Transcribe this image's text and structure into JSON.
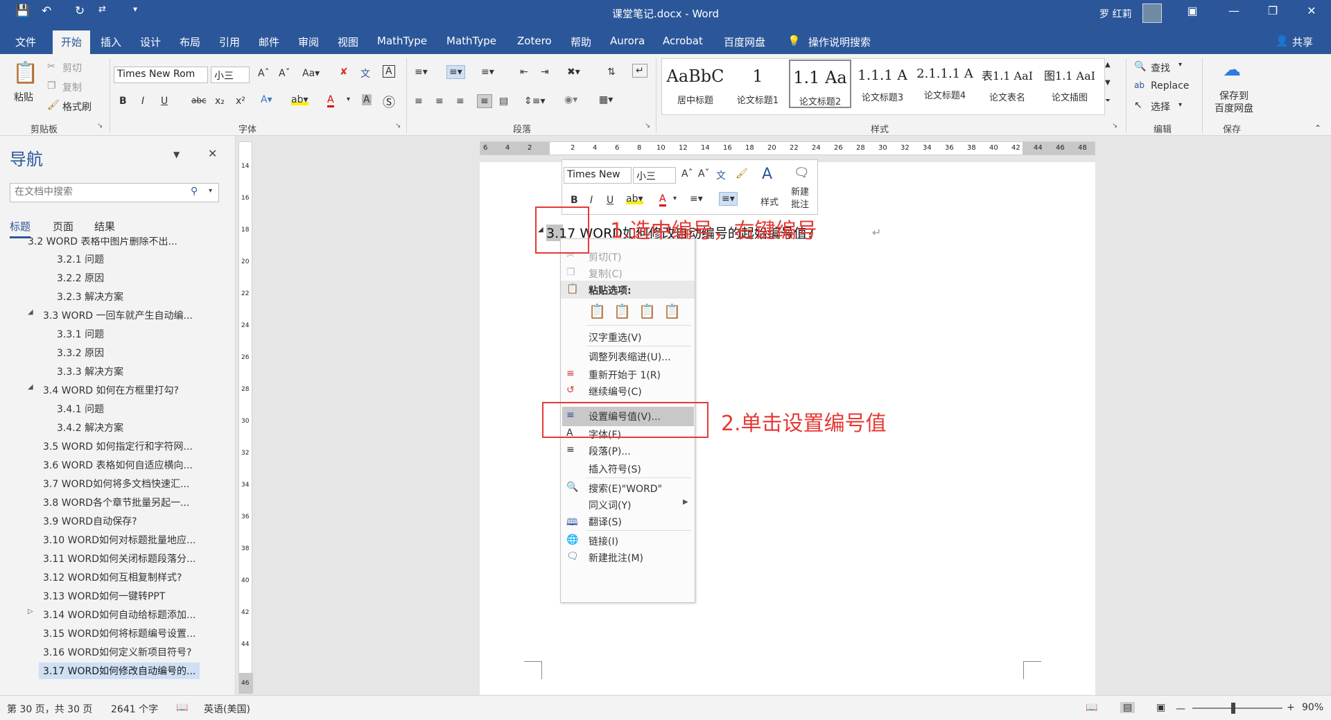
{
  "titlebar": {
    "title": "课堂笔记.docx - Word",
    "user": "罗 红莉",
    "undo_icon": "undo-icon",
    "redo_icon": "redo-icon"
  },
  "tabs": [
    "文件",
    "开始",
    "插入",
    "设计",
    "布局",
    "引用",
    "邮件",
    "审阅",
    "视图",
    "MathType",
    "MathType",
    "Zotero",
    "帮助",
    "Aurora",
    "Acrobat",
    "百度网盘",
    "操作说明搜索"
  ],
  "share": "共享",
  "ribbon": {
    "clipboard": {
      "paste": "粘贴",
      "cut": "剪切",
      "copy": "复制",
      "format_painter": "格式刷",
      "label": "剪贴板"
    },
    "font": {
      "font_name": "Times New Rom",
      "font_size": "小三",
      "label": "字体"
    },
    "paragraph": {
      "label": "段落"
    },
    "styles": {
      "label": "样式",
      "tiles": [
        {
          "preview": "AaBbC",
          "name": "居中标题"
        },
        {
          "preview": "1",
          "name": "论文标题1"
        },
        {
          "preview": "1.1 Aa",
          "name": "论文标题2"
        },
        {
          "preview": "1.1.1 A",
          "name": "论文标题3"
        },
        {
          "preview": "2.1.1.1 A",
          "name": "论文标题4"
        },
        {
          "preview": "表1.1 AaI",
          "name": "论文表名"
        },
        {
          "preview": "图1.1 AaI",
          "name": "论文插图"
        }
      ]
    },
    "editing": {
      "find": "查找",
      "replace": "Replace",
      "select": "选择",
      "label": "编辑"
    },
    "save": {
      "button": "保存到百度网盘",
      "line1": "保存到",
      "line2": "百度网盘",
      "label": "保存"
    }
  },
  "nav": {
    "title": "导航",
    "search_placeholder": "在文档中搜索",
    "tabs": [
      "标题",
      "页面",
      "结果"
    ],
    "items": [
      "3.2 WORD 表格中图片删除不出...",
      "3.2.1 问题",
      "3.2.2 原因",
      "3.2.3 解决方案",
      "3.3 WORD 一回车就产生自动编...",
      "3.3.1 问题",
      "3.3.2 原因",
      "3.3.3 解决方案",
      "3.4 WORD 如何在方框里打勾?",
      "3.4.1 问题",
      "3.4.2 解决方案",
      "3.5 WORD 如何指定行和字符网...",
      "3.6 WORD 表格如何自适应横向...",
      "3.7 WORD如何将多文档快速汇...",
      "3.8 WORD各个章节批量另起一...",
      "3.9 WORD自动保存?",
      "3.10 WORD如何对标题批量地应...",
      "3.11 WORD如何关闭标题段落分...",
      "3.12 WORD如何互相复制样式?",
      "3.13 WORD如何一键转PPT",
      "3.14 WORD如何自动给标题添加...",
      "3.15 WORD如何将标题编号设置...",
      "3.16 WORD如何定义新项目符号?",
      "3.17 WORD如何修改自动编号的..."
    ]
  },
  "doc": {
    "heading": "3.17 WORD如何修改自动编号的起始编号值?",
    "mini_font": "Times New",
    "mini_size": "小三",
    "mini_styles": "样式",
    "mini_comment": "新建批注",
    "mini_comment_l1": "新建",
    "mini_comment_l2": "批注"
  },
  "context_menu": {
    "cut": "剪切(T)",
    "copy": "复制(C)",
    "paste_options": "粘贴选项:",
    "reconvert": "汉字重选(V)",
    "adjust_indent": "调整列表缩进(U)...",
    "restart": "重新开始于 1(R)",
    "continue": "继续编号(C)",
    "set_value": "设置编号值(V)...",
    "font": "字体(F)...",
    "paragraph": "段落(P)...",
    "insert_symbol": "插入符号(S)",
    "search": "搜索(E)\"WORD\"",
    "synonyms": "同义词(Y)",
    "translate": "翻译(S)",
    "link": "链接(I)",
    "new_comment": "新建批注(M)"
  },
  "annotations": {
    "step1": "1.选中编号，右键编号",
    "step2": "2.单击设置编号值"
  },
  "status": {
    "page": "第 30 页，共 30 页",
    "words": "2641 个字",
    "lang": "英语(美国)",
    "zoom": "90%"
  },
  "ruler": {
    "h_left": [
      "6",
      "4",
      "2"
    ],
    "h": [
      "2",
      "4",
      "6",
      "8",
      "10",
      "12",
      "14",
      "16",
      "18",
      "20",
      "22",
      "24",
      "26",
      "28",
      "30",
      "32",
      "34",
      "36",
      "38",
      "40",
      "42",
      "44",
      "46",
      "48"
    ],
    "v": [
      "14",
      "16",
      "18",
      "20",
      "22",
      "24",
      "26",
      "28",
      "30",
      "32",
      "34",
      "36",
      "38",
      "40",
      "42",
      "44",
      "46"
    ]
  },
  "colors": {
    "brand": "#2b579a",
    "annotation": "#e53935",
    "selection": "#cfe0f5"
  }
}
